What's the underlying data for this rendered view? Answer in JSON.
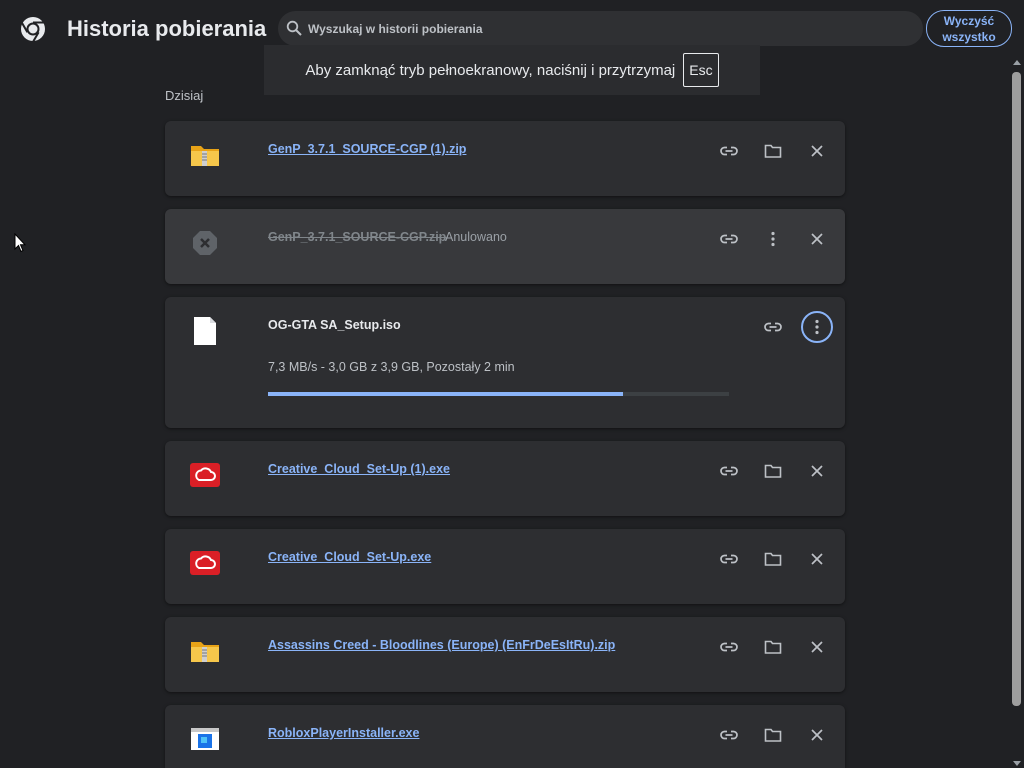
{
  "header": {
    "title": "Historia pobierania",
    "search_placeholder": "Wyszukaj w historii pobierania",
    "clear_all_label": "Wyczyść wszystko"
  },
  "toast": {
    "message": "Aby zamknąć tryb pełnoekranowy, naciśnij i przytrzymaj",
    "key": "Esc"
  },
  "section": {
    "label": "Dzisiaj"
  },
  "downloads": [
    {
      "name": "GenP_3.7.1_SOURCE-CGP (1).zip",
      "icon": "zip-folder-icon"
    },
    {
      "name": "GenP_3.7.1_SOURCE-CGP.zip",
      "status": "Anulowano",
      "icon": "cancelled-icon"
    },
    {
      "name": "OG-GTA SA_Setup.iso",
      "progress_text": "7,3 MB/s - 3,0 GB z 3,9 GB, Pozostały 2 min",
      "progress": 0.77,
      "icon": "document-icon"
    },
    {
      "name": "Creative_Cloud_Set-Up (1).exe",
      "icon": "creative-cloud-icon"
    },
    {
      "name": "Creative_Cloud_Set-Up.exe",
      "icon": "creative-cloud-icon"
    },
    {
      "name": "Assassins Creed - Bloodlines (Europe) (EnFrDeEsItRu).zip",
      "icon": "zip-folder-icon"
    },
    {
      "name": "RobloxPlayerInstaller.exe",
      "icon": "installer-window-icon"
    }
  ],
  "colors": {
    "background": "#202124",
    "card": "#2d2e31",
    "link": "#8ab4f8",
    "creative_cloud_red": "#da1f26"
  }
}
